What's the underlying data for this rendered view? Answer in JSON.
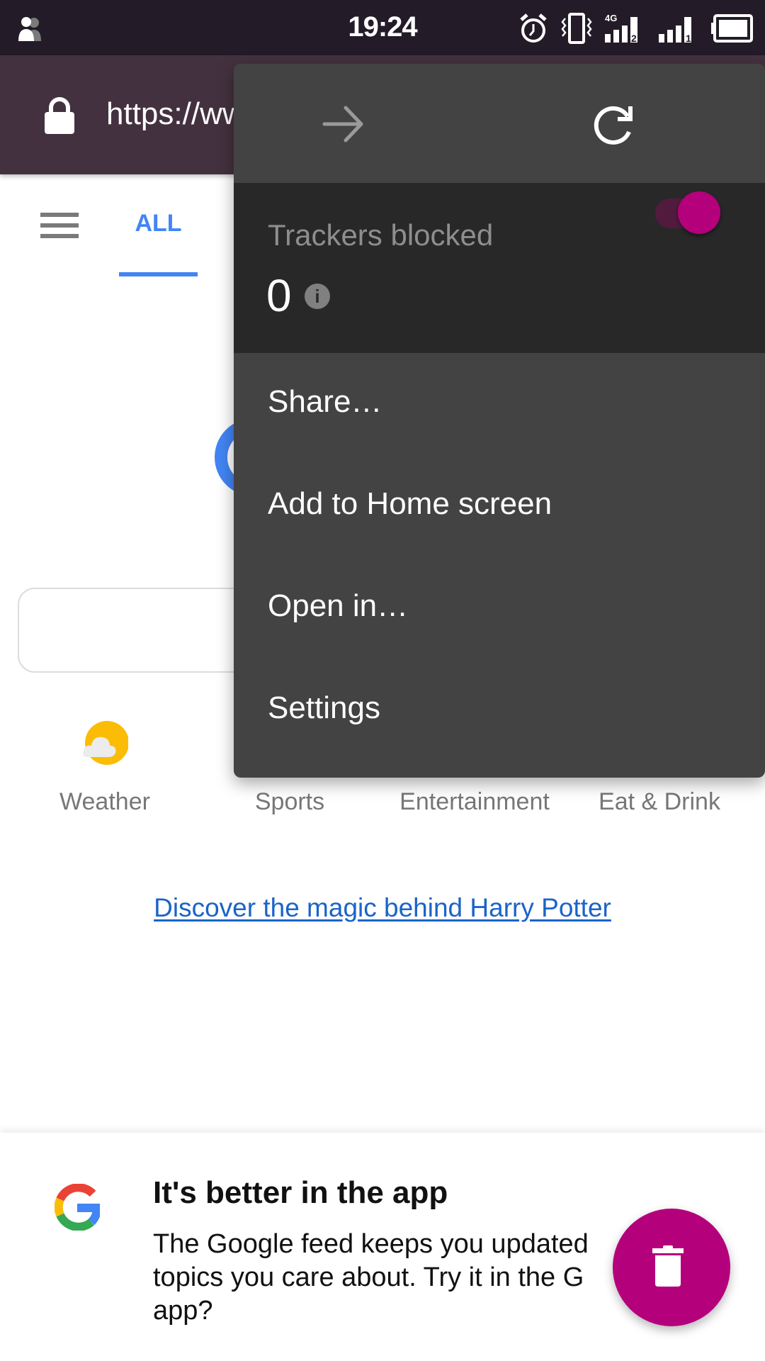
{
  "status_bar": {
    "time": "19:24",
    "icons": [
      "users-icon",
      "alarm-icon",
      "vibrate-icon",
      "signal-4g-sim2-icon",
      "signal-sim1-icon",
      "battery-icon"
    ],
    "network_label": "4G",
    "sim2_label": "2",
    "sim1_label": "1"
  },
  "url_bar": {
    "url": "https://ww"
  },
  "page": {
    "tabs": [
      {
        "label": "ALL",
        "active": true
      }
    ],
    "shortcuts": [
      {
        "label": "Weather",
        "icon": "weather-partly-cloudy-icon"
      },
      {
        "label": "Sports"
      },
      {
        "label": "Entertainment"
      },
      {
        "label": "Eat & Drink"
      }
    ],
    "promo_link": "Discover the magic behind Harry Potter",
    "colors": {
      "accent": "#4285f4",
      "link": "#1a64c8"
    }
  },
  "app_banner": {
    "title": "It's better in the app",
    "body": "The Google feed keeps you updated on topics you care about. Try it in the Google app?",
    "body_visible_lines": [
      "The Google feed keeps you updated",
      "topics you care about. Try it in the G",
      "app?"
    ]
  },
  "fab": {
    "icon": "trash-icon",
    "color": "#b4007b"
  },
  "menu": {
    "nav": [
      {
        "icon": "arrow-forward-icon",
        "enabled": false
      },
      {
        "icon": "reload-icon",
        "enabled": true
      }
    ],
    "trackers": {
      "label": "Trackers blocked",
      "count": "0",
      "info_glyph": "i",
      "toggle_on": true,
      "toggle_color": "#b4007b"
    },
    "items": [
      {
        "label": "Share…"
      },
      {
        "label": "Add to Home screen"
      },
      {
        "label": "Open in…"
      },
      {
        "label": "Settings"
      }
    ]
  }
}
